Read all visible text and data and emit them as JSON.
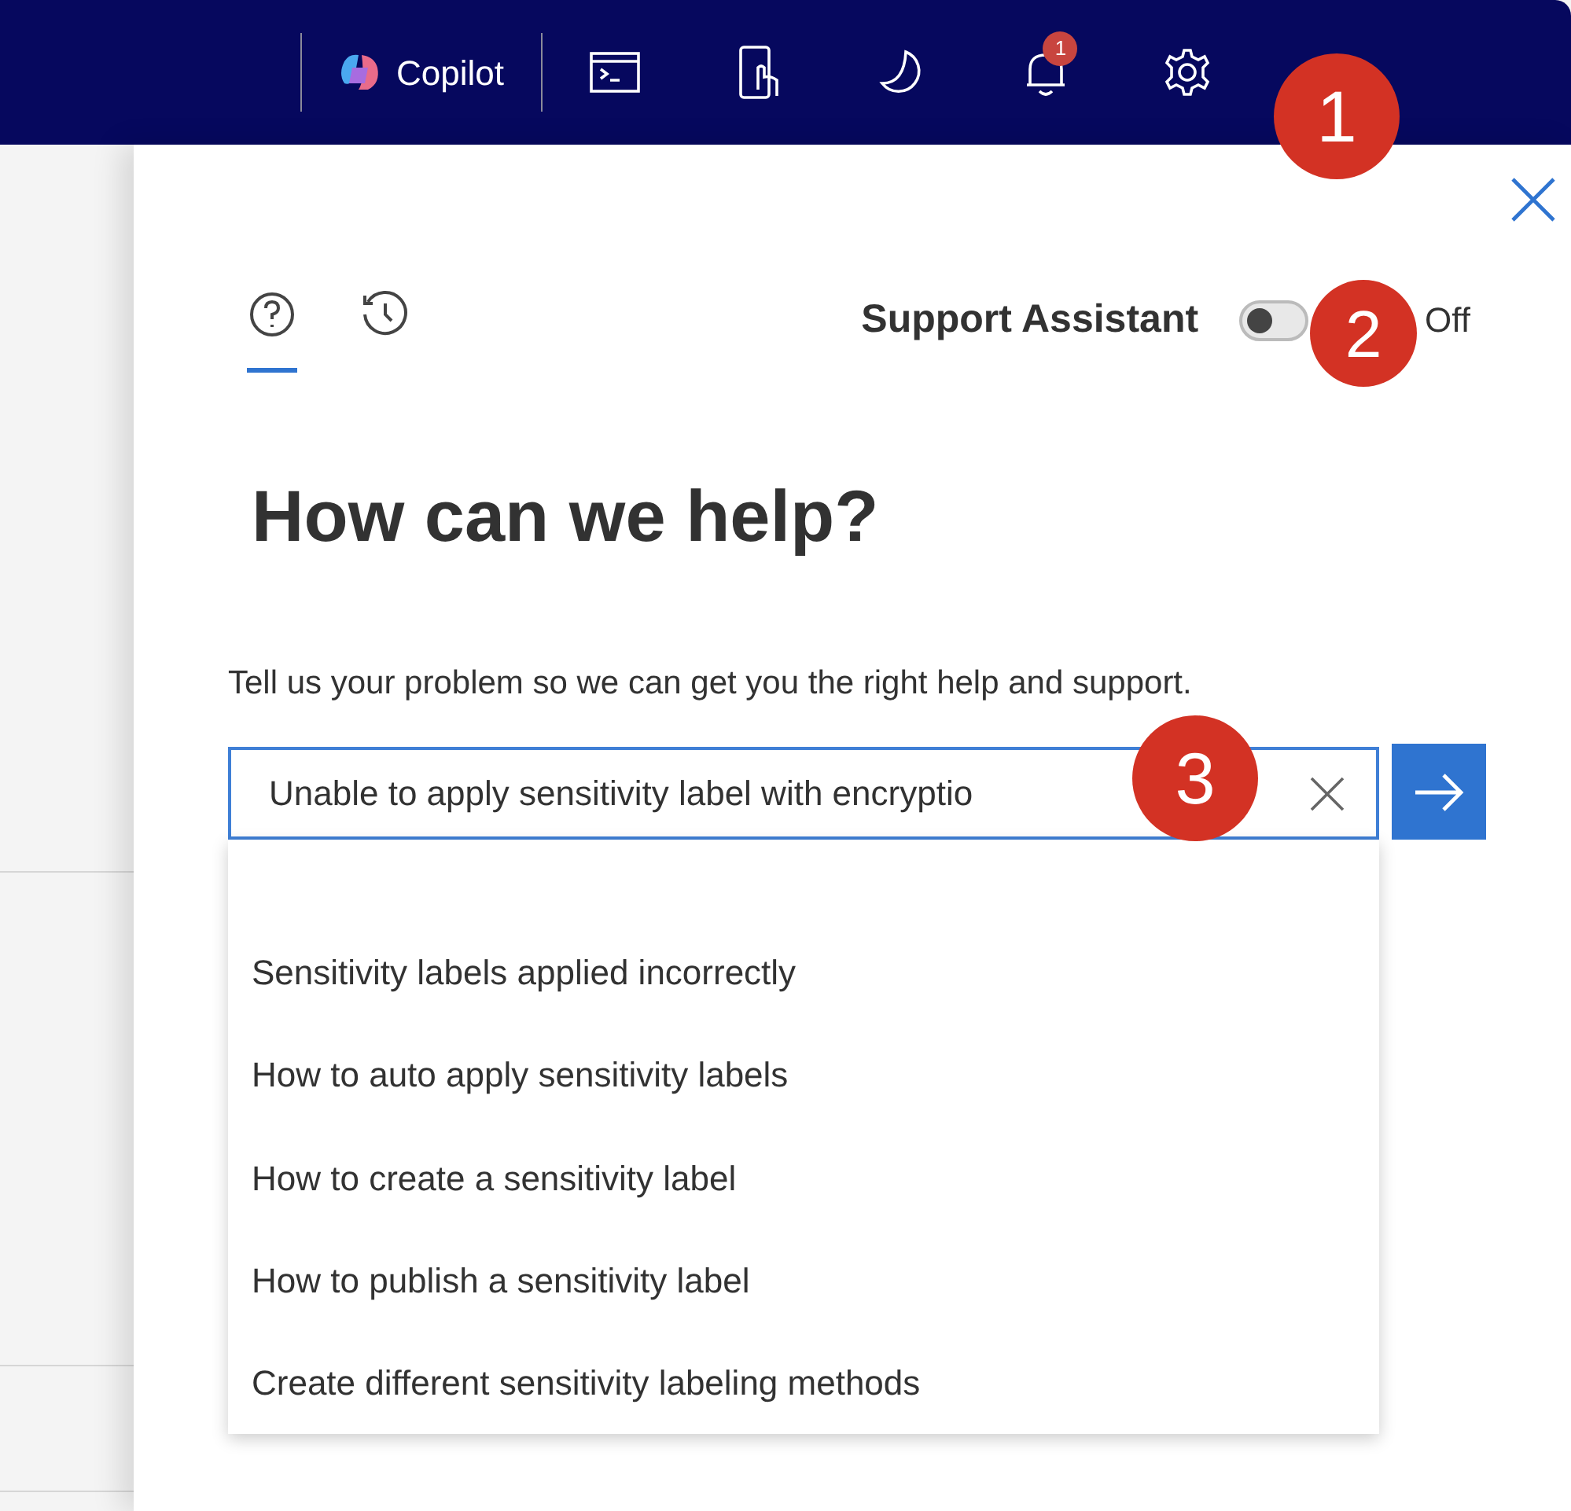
{
  "top_bar": {
    "copilot_label": "Copilot",
    "notification_count": "1"
  },
  "panel": {
    "tabs": [
      {
        "kind": "help",
        "selected": true
      },
      {
        "kind": "history",
        "selected": false
      }
    ],
    "support_assistant": {
      "label": "Support Assistant",
      "on": false,
      "state_label": "Off"
    },
    "heading": "How can we help?",
    "description": "Tell us your problem so we can get you the right help and support.",
    "search": {
      "value": "Unable to apply sensitivity label with encryptio"
    },
    "suggestions": [
      "Sensitivity labels applied incorrectly",
      "How to auto apply sensitivity labels",
      "How to create a sensitivity label",
      "How to publish a sensitivity label",
      "Create different sensitivity labeling methods"
    ]
  },
  "callouts": [
    "1",
    "2",
    "3"
  ]
}
